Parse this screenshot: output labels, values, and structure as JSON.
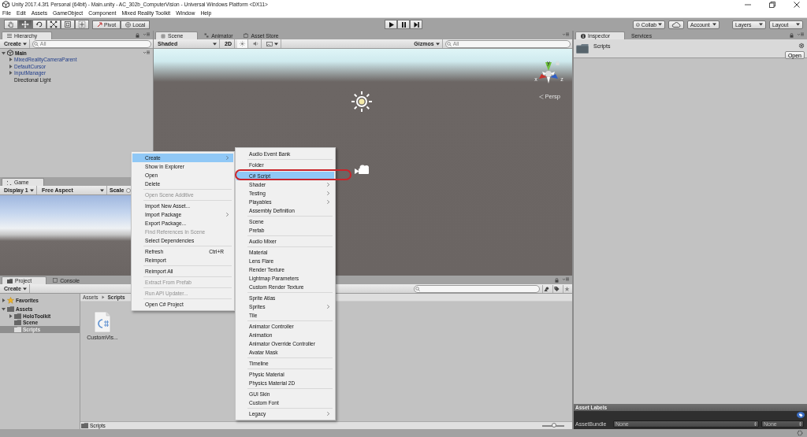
{
  "window": {
    "title": "Unity 2017.4.3f1 Personal (64bit) - Main.unity - AC_302b_ComputerVision - Universal Windows Platform <DX11>"
  },
  "menu_bar": [
    "File",
    "Edit",
    "Assets",
    "GameObject",
    "Component",
    "Mixed Reality Toolkit",
    "Window",
    "Help"
  ],
  "toolbar": {
    "tools": [
      {
        "kind": "hand",
        "selected": false
      },
      {
        "kind": "move",
        "selected": true
      },
      {
        "kind": "rotate",
        "selected": false
      },
      {
        "kind": "scale",
        "selected": false
      },
      {
        "kind": "rect",
        "selected": false
      },
      {
        "kind": "transform",
        "selected": false
      }
    ],
    "pivot": "Pivot",
    "space": "Local",
    "collab": "Collab",
    "account": "Account",
    "layers": "Layers",
    "layout": "Layout"
  },
  "hierarchy": {
    "tab": "Hierarchy",
    "create": "Create",
    "search": {
      "placeholder": "All"
    },
    "tree": [
      {
        "label": "Main",
        "kind": "scene",
        "expanded": true,
        "children": [
          {
            "label": "MixedRealityCameraParent",
            "kind": "prefab",
            "expanded": false
          },
          {
            "label": "DefaultCursor",
            "kind": "prefab",
            "expanded": false
          },
          {
            "label": "InputManager",
            "kind": "prefab",
            "expanded": false
          },
          {
            "label": "Directional Light",
            "kind": "object"
          }
        ]
      }
    ]
  },
  "scene_view": {
    "tabs": [
      {
        "label": "Scene",
        "selected": true
      },
      {
        "label": "Animator",
        "selected": false
      },
      {
        "label": "Asset Store",
        "selected": false
      }
    ],
    "shading": "Shaded",
    "mode_2d": "2D",
    "gizmos": "Gizmos",
    "search": {
      "placeholder": "All"
    },
    "axes": [
      {
        "label": "y",
        "color": "#6cc23a"
      },
      {
        "label": "x",
        "color": "#c8312c"
      },
      {
        "label": "z",
        "color": "#2f5fc8"
      }
    ],
    "projection": "Persp"
  },
  "game_view": {
    "tab": "Game",
    "display": "Display 1",
    "aspect": "Free Aspect",
    "scale_label": "Scale"
  },
  "project": {
    "tabs": [
      {
        "label": "Project",
        "selected": true
      },
      {
        "label": "Console",
        "selected": false
      }
    ],
    "create": "Create",
    "tree": [
      {
        "label": "Favorites",
        "kind": "favorites",
        "expanded": false,
        "selected": false
      },
      {
        "label": "Assets",
        "kind": "folder",
        "expanded": true,
        "selected": false,
        "children": [
          {
            "label": "HoloToolkit",
            "kind": "folder",
            "expanded": false,
            "selected": false
          },
          {
            "label": "Scene",
            "kind": "folder",
            "selected": false
          },
          {
            "label": "Scripts",
            "kind": "folder",
            "selected": true
          }
        ]
      }
    ],
    "breadcrumb": [
      "Assets",
      "Scripts"
    ],
    "files": [
      {
        "name": "CustomVis...",
        "kind": "script"
      }
    ],
    "path": "Scripts",
    "icon_size_slider": {
      "level": 0.55
    }
  },
  "inspector": {
    "tabs": [
      {
        "label": "Inspector",
        "selected": true
      },
      {
        "label": "Services",
        "selected": false
      }
    ],
    "asset_name": "Scripts",
    "open_button": "Open",
    "labels_title": "Asset Labels",
    "asset_bundle": {
      "label": "AssetBundle",
      "name": "None",
      "variant": "None"
    }
  },
  "context_menu": {
    "items": [
      {
        "kind": "item",
        "label": "Create",
        "submenu": true,
        "selected": true,
        "disabled": false
      },
      {
        "kind": "item",
        "label": "Show in Explorer",
        "submenu": false,
        "selected": false,
        "disabled": false
      },
      {
        "kind": "item",
        "label": "Open",
        "submenu": false,
        "selected": false,
        "disabled": false
      },
      {
        "kind": "item",
        "label": "Delete",
        "submenu": false,
        "selected": false,
        "disabled": false
      },
      {
        "kind": "separator"
      },
      {
        "kind": "item",
        "label": "Open Scene Additive",
        "submenu": false,
        "selected": false,
        "disabled": true
      },
      {
        "kind": "separator"
      },
      {
        "kind": "item",
        "label": "Import New Asset...",
        "submenu": false,
        "selected": false,
        "disabled": false
      },
      {
        "kind": "item",
        "label": "Import Package",
        "submenu": true,
        "selected": false,
        "disabled": false
      },
      {
        "kind": "item",
        "label": "Export Package...",
        "submenu": false,
        "selected": false,
        "disabled": false
      },
      {
        "kind": "item",
        "label": "Find References In Scene",
        "submenu": false,
        "selected": false,
        "disabled": true
      },
      {
        "kind": "item",
        "label": "Select Dependencies",
        "submenu": false,
        "selected": false,
        "disabled": false
      },
      {
        "kind": "separator"
      },
      {
        "kind": "item",
        "label": "Refresh",
        "shortcut": "Ctrl+R",
        "submenu": false,
        "selected": false,
        "disabled": false
      },
      {
        "kind": "item",
        "label": "Reimport",
        "submenu": false,
        "selected": false,
        "disabled": false
      },
      {
        "kind": "separator"
      },
      {
        "kind": "item",
        "label": "Reimport All",
        "submenu": false,
        "selected": false,
        "disabled": false
      },
      {
        "kind": "separator"
      },
      {
        "kind": "item",
        "label": "Extract From Prefab",
        "submenu": false,
        "selected": false,
        "disabled": true
      },
      {
        "kind": "separator"
      },
      {
        "kind": "item",
        "label": "Run API Updater...",
        "submenu": false,
        "selected": false,
        "disabled": true
      },
      {
        "kind": "separator"
      },
      {
        "kind": "item",
        "label": "Open C# Project",
        "submenu": false,
        "selected": false,
        "disabled": false
      }
    ]
  },
  "create_submenu": {
    "items": [
      {
        "kind": "item",
        "label": "Audio Event Bank",
        "submenu": false,
        "selected": false
      },
      {
        "kind": "separator"
      },
      {
        "kind": "item",
        "label": "Folder",
        "submenu": false,
        "selected": false
      },
      {
        "kind": "separator"
      },
      {
        "kind": "item",
        "label": "C# Script",
        "submenu": false,
        "selected": true
      },
      {
        "kind": "item",
        "label": "Shader",
        "submenu": true,
        "selected": false
      },
      {
        "kind": "item",
        "label": "Testing",
        "submenu": true,
        "selected": false
      },
      {
        "kind": "item",
        "label": "Playables",
        "submenu": true,
        "selected": false
      },
      {
        "kind": "item",
        "label": "Assembly Definition",
        "submenu": false,
        "selected": false
      },
      {
        "kind": "separator"
      },
      {
        "kind": "item",
        "label": "Scene",
        "submenu": false,
        "selected": false
      },
      {
        "kind": "item",
        "label": "Prefab",
        "submenu": false,
        "selected": false
      },
      {
        "kind": "separator"
      },
      {
        "kind": "item",
        "label": "Audio Mixer",
        "submenu": false,
        "selected": false
      },
      {
        "kind": "separator"
      },
      {
        "kind": "item",
        "label": "Material",
        "submenu": false,
        "selected": false
      },
      {
        "kind": "item",
        "label": "Lens Flare",
        "submenu": false,
        "selected": false
      },
      {
        "kind": "item",
        "label": "Render Texture",
        "submenu": false,
        "selected": false
      },
      {
        "kind": "item",
        "label": "Lightmap Parameters",
        "submenu": false,
        "selected": false
      },
      {
        "kind": "item",
        "label": "Custom Render Texture",
        "submenu": false,
        "selected": false
      },
      {
        "kind": "separator"
      },
      {
        "kind": "item",
        "label": "Sprite Atlas",
        "submenu": false,
        "selected": false
      },
      {
        "kind": "item",
        "label": "Sprites",
        "submenu": true,
        "selected": false
      },
      {
        "kind": "item",
        "label": "Tile",
        "submenu": false,
        "selected": false
      },
      {
        "kind": "separator"
      },
      {
        "kind": "item",
        "label": "Animator Controller",
        "submenu": false,
        "selected": false
      },
      {
        "kind": "item",
        "label": "Animation",
        "submenu": false,
        "selected": false
      },
      {
        "kind": "item",
        "label": "Animator Override Controller",
        "submenu": false,
        "selected": false
      },
      {
        "kind": "item",
        "label": "Avatar Mask",
        "submenu": false,
        "selected": false
      },
      {
        "kind": "separator"
      },
      {
        "kind": "item",
        "label": "Timeline",
        "submenu": false,
        "selected": false
      },
      {
        "kind": "separator"
      },
      {
        "kind": "item",
        "label": "Physic Material",
        "submenu": false,
        "selected": false
      },
      {
        "kind": "item",
        "label": "Physics Material 2D",
        "submenu": false,
        "selected": false
      },
      {
        "kind": "separator"
      },
      {
        "kind": "item",
        "label": "GUI Skin",
        "submenu": false,
        "selected": false
      },
      {
        "kind": "item",
        "label": "Custom Font",
        "submenu": false,
        "selected": false
      },
      {
        "kind": "separator"
      },
      {
        "kind": "item",
        "label": "Legacy",
        "submenu": true,
        "selected": false
      }
    ]
  }
}
